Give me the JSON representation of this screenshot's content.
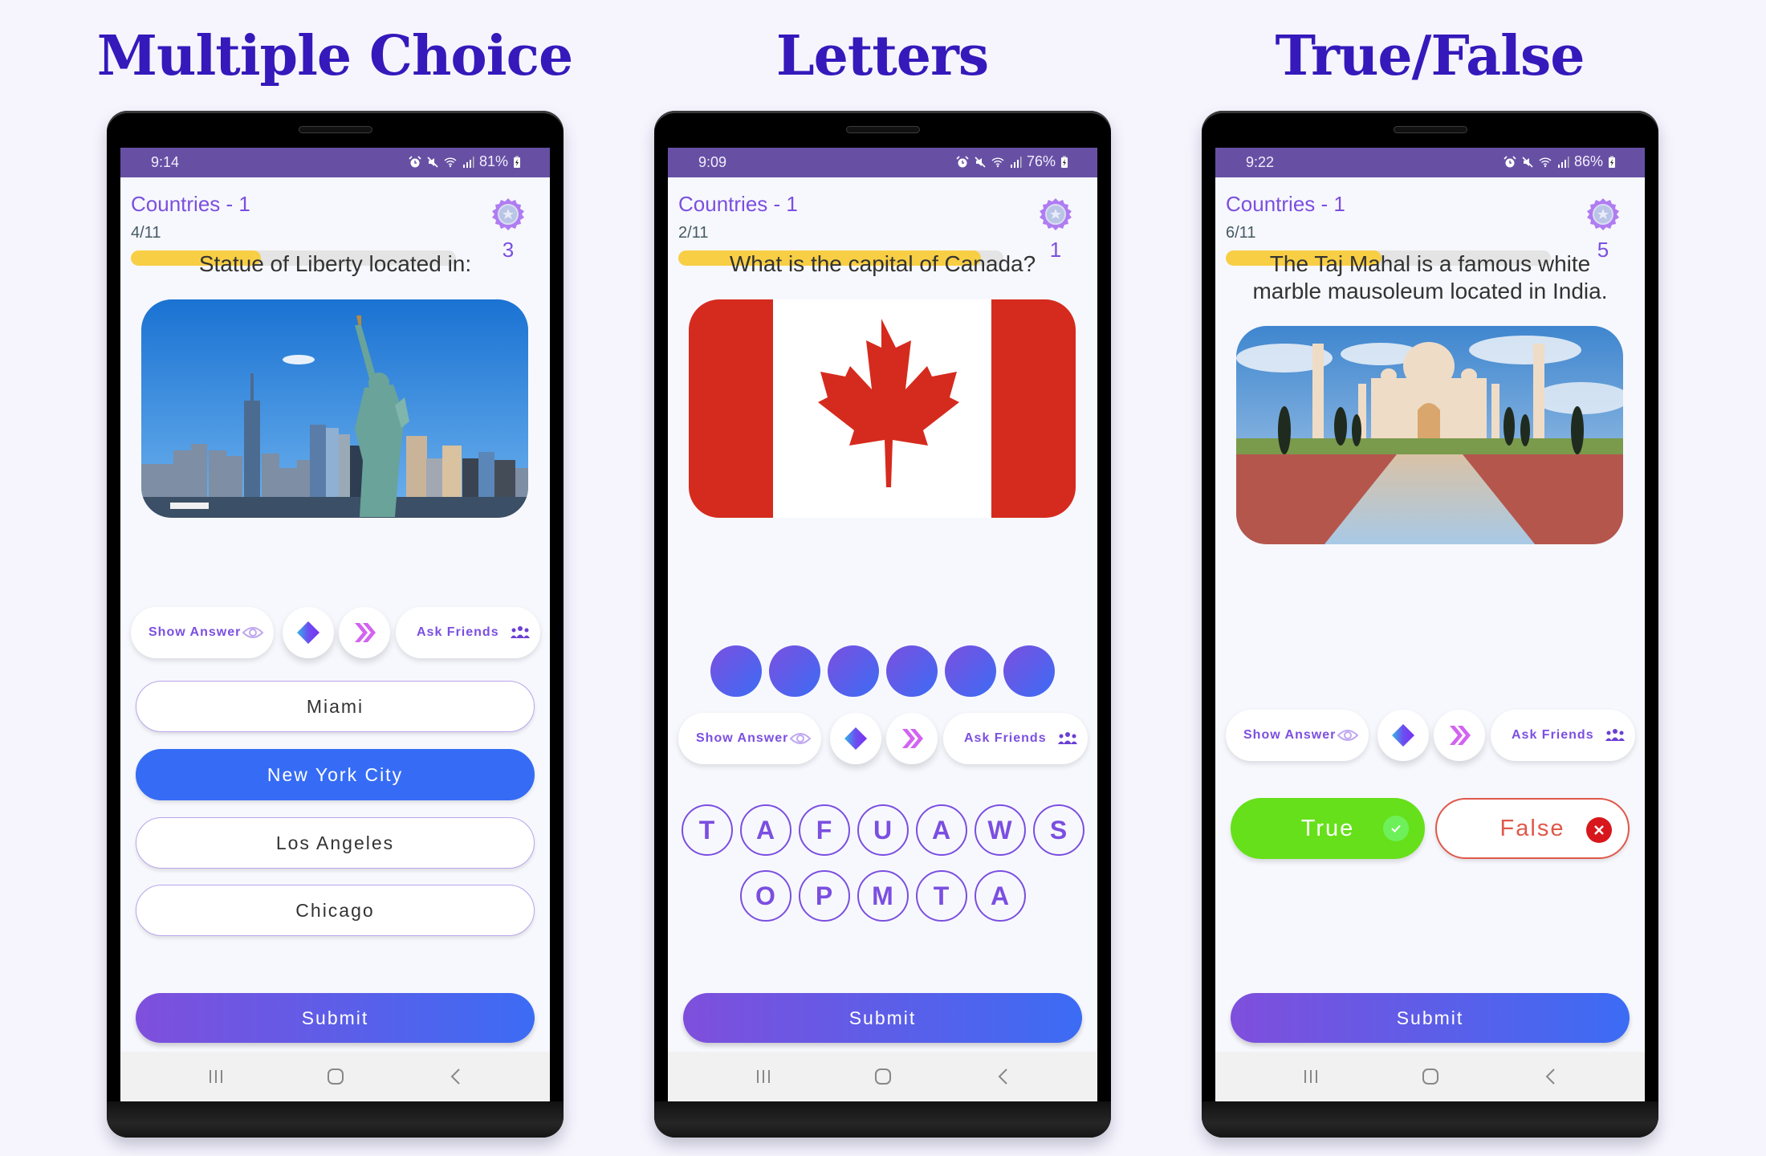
{
  "titles": [
    "Multiple Choice",
    "Letters",
    "True/False"
  ],
  "colors": {
    "title": "#3519bb",
    "status_bar": "#6750a4",
    "accent_purple": "#7b4fe0",
    "progress_fill": "#f8ce45",
    "selected_option": "#366cf5",
    "true_green": "#66e01a",
    "false_red": "#e0584a"
  },
  "phones": [
    {
      "status": {
        "time": "9:14",
        "battery": "81%",
        "icons": [
          "alarm-icon",
          "mute-icon",
          "wifi-icon",
          "signal-icon",
          "battery-charging-icon"
        ]
      },
      "header": {
        "category": "Countries - 1",
        "progress_text": "4/11",
        "progress": 0.4,
        "score": "3",
        "badge_icon": "badge-star-icon"
      },
      "question": "Statue of Liberty located in:",
      "image": "statue-of-liberty-nyc-skyline",
      "help": {
        "show_answer": "Show Answer",
        "ask_friends": "Ask Friends",
        "icons": [
          "eye-icon",
          "eraser-icon",
          "skip-icon",
          "friends-icon"
        ]
      },
      "options": [
        {
          "label": "Miami",
          "selected": false
        },
        {
          "label": "New York City",
          "selected": true
        },
        {
          "label": "Los Angeles",
          "selected": false
        },
        {
          "label": "Chicago",
          "selected": false
        }
      ],
      "submit": "Submit",
      "nav": [
        "recents-icon",
        "home-icon",
        "back-icon"
      ]
    },
    {
      "status": {
        "time": "9:09",
        "battery": "76%",
        "icons": [
          "alarm-icon",
          "mute-icon",
          "wifi-icon",
          "signal-icon",
          "battery-charging-icon"
        ]
      },
      "header": {
        "category": "Countries - 1",
        "progress_text": "2/11",
        "progress": 0.93,
        "score": "1",
        "badge_icon": "badge-star-icon"
      },
      "question": "What is the capital of Canada?",
      "image": "canada-flag",
      "answer_slots": 6,
      "help": {
        "show_answer": "Show Answer",
        "ask_friends": "Ask Friends",
        "icons": [
          "eye-icon",
          "eraser-icon",
          "skip-icon",
          "friends-icon"
        ]
      },
      "letters": [
        "T",
        "A",
        "F",
        "U",
        "A",
        "W",
        "S",
        "O",
        "P",
        "M",
        "T",
        "A"
      ],
      "submit": "Submit",
      "nav": [
        "recents-icon",
        "home-icon",
        "back-icon"
      ]
    },
    {
      "status": {
        "time": "9:22",
        "battery": "86%",
        "icons": [
          "alarm-icon",
          "mute-icon",
          "wifi-icon",
          "signal-icon",
          "battery-charging-icon"
        ]
      },
      "header": {
        "category": "Countries - 1",
        "progress_text": "6/11",
        "progress": 0.48,
        "score": "5",
        "badge_icon": "badge-star-icon"
      },
      "question_line1": "The Taj Mahal is a famous white",
      "question_line2": "marble mausoleum located in India.",
      "image": "taj-mahal",
      "help": {
        "show_answer": "Show Answer",
        "ask_friends": "Ask Friends",
        "icons": [
          "eye-icon",
          "eraser-icon",
          "skip-icon",
          "friends-icon"
        ]
      },
      "true_label": "True",
      "false_label": "False",
      "submit": "Submit",
      "nav": [
        "recents-icon",
        "home-icon",
        "back-icon"
      ]
    }
  ]
}
